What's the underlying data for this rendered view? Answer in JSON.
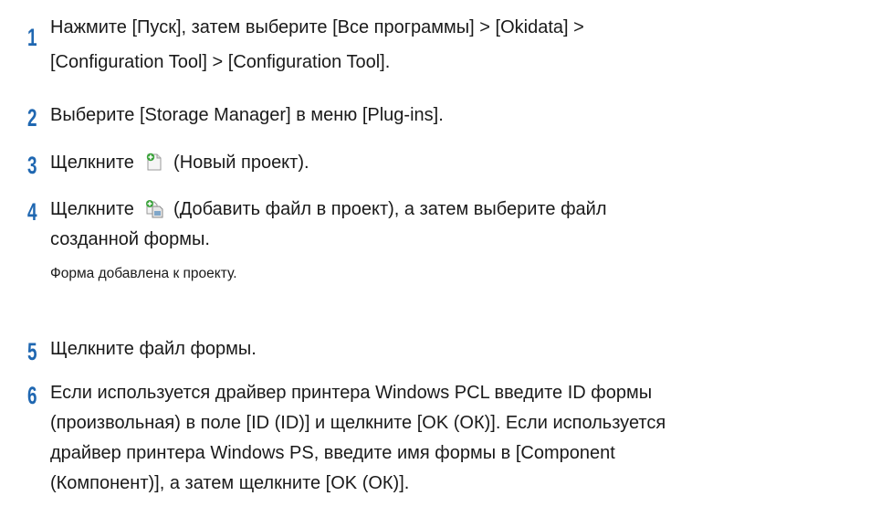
{
  "steps": [
    {
      "number": "1",
      "lines": [
        "Нажмите [Пуск], затем выберите [Все программы] > [Okidata] >",
        "[Configuration Tool] > [Configuration Tool]."
      ]
    },
    {
      "number": "2",
      "lines": [
        "Выберите [Storage Manager] в меню [Plug-ins]."
      ]
    },
    {
      "number": "3",
      "before_icon": "Щелкните",
      "icon": "new-project-icon",
      "after_icon": "(Новый проект)."
    },
    {
      "number": "4",
      "before_icon": "Щелкните",
      "icon": "add-file-to-project-icon",
      "after_icon": "(Добавить файл в проект), а затем выберите файл",
      "line2": "созданной формы.",
      "note": "Форма добавлена к проекту."
    },
    {
      "number": "5",
      "lines": [
        "Щелкните файл формы."
      ]
    },
    {
      "number": "6",
      "lines": [
        "Если используется драйвер принтера Windows PCL введите ID формы",
        "(произвольная) в поле [ID (ID)] и щелкните [OK (ОК)]. Если используется",
        "драйвер принтера Windows PS, введите имя формы в [Component",
        "(Компонент)], а затем щелкните [OK (ОК)]."
      ]
    }
  ],
  "colors": {
    "step_number": "#1f67b1",
    "text": "#1a1a1a"
  }
}
